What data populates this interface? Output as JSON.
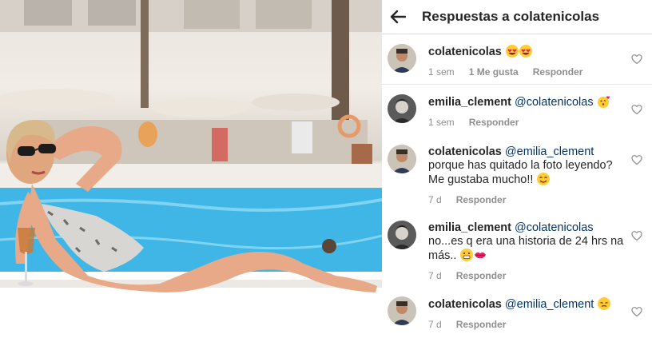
{
  "header": {
    "title": "Respuestas a colatenicolas",
    "back_icon": "arrow-left-icon"
  },
  "comments": [
    {
      "username": "colatenicolas",
      "mention": "",
      "text": "",
      "emojis": [
        "heart-eyes-emoji",
        "heart-eyes-emoji"
      ],
      "time": "1 sem",
      "likes": "1 Me gusta",
      "reply": "Responder"
    },
    {
      "username": "emilia_clement",
      "mention": "@colatenicolas",
      "text": "",
      "emojis": [
        "kissing-heart-emoji"
      ],
      "time": "1 sem",
      "likes": "",
      "reply": "Responder"
    },
    {
      "username": "colatenicolas",
      "mention": "@emilia_clement",
      "text": "porque has quitado la foto leyendo? Me gustaba mucho!!",
      "emojis": [
        "smiling-emoji"
      ],
      "time": "7 d",
      "likes": "",
      "reply": "Responder"
    },
    {
      "username": "emilia_clement",
      "mention": "@colatenicolas",
      "text": "no...es q era una historia de 24 hrs na más..",
      "emojis": [
        "grimacing-emoji",
        "kiss-lips-emoji"
      ],
      "time": "7 d",
      "likes": "",
      "reply": "Responder"
    },
    {
      "username": "colatenicolas",
      "mention": "@emilia_clement",
      "text": "",
      "emojis": [
        "sleepy-emoji"
      ],
      "time": "7 d",
      "likes": "",
      "reply": "Responder"
    }
  ],
  "colors": {
    "text": "#262626",
    "mention": "#003569",
    "meta": "#8e8e8e",
    "pool": "#3fb6e6",
    "emoji": "#ffcc33"
  }
}
